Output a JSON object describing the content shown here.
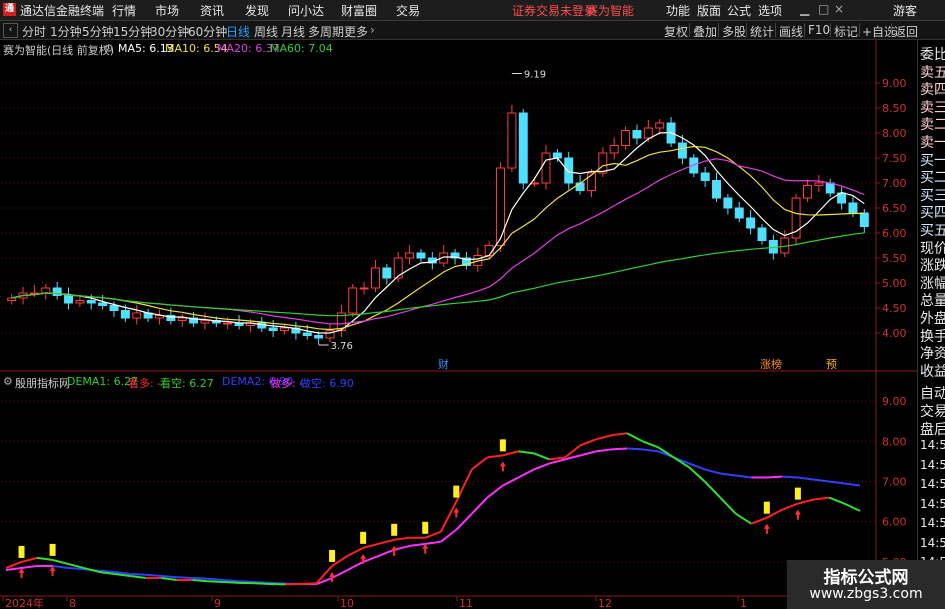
{
  "menubar": {
    "app_title": "通达信金融终端",
    "items": [
      "行情",
      "市场",
      "资讯",
      "发现",
      "问小达",
      "财富圈",
      "交易"
    ],
    "login_notice": "证券交易未登录",
    "stock_name": "赛为智能",
    "right_items": [
      "功能",
      "版面",
      "公式",
      "选项"
    ],
    "guest": "游客",
    "corner": "R"
  },
  "toolbar": {
    "periods": [
      "分时",
      "1分钟",
      "5分钟",
      "15分钟",
      "30分钟",
      "60分钟",
      "日线",
      "周线",
      "月线",
      "多周期",
      "更多"
    ],
    "active": "日线",
    "right_buttons": [
      "复权",
      "叠加",
      "多股",
      "统计",
      "画线",
      "F10",
      "标记",
      "+自选",
      "返回"
    ]
  },
  "main_chart": {
    "title": "赛为智能(日线 前复权)",
    "legend": [
      {
        "label": "MA5: 6.13",
        "color": "#ffffff"
      },
      {
        "label": "MA10: 6.54",
        "color": "#f0e040"
      },
      {
        "label": "MA20: 6.37",
        "color": "#e040e0"
      },
      {
        "label": "MA60: 7.04",
        "color": "#30d030"
      }
    ],
    "high_label": "9.19",
    "low_label": "3.76",
    "event_labels": [
      "财",
      "涨榜",
      "预"
    ],
    "y_ticks": [
      "9.00",
      "8.50",
      "8.00",
      "7.50",
      "7.00",
      "6.50",
      "6.00",
      "5.50",
      "5.00",
      "4.50",
      "4.00"
    ]
  },
  "indicator": {
    "name": "殷朋指标网",
    "legend": [
      {
        "label": "DEMA1: 6.27",
        "color": "#30d030"
      },
      {
        "label": "看多: -",
        "color": "#ff3030"
      },
      {
        "label": "看空: 6.27",
        "color": "#30d030"
      },
      {
        "label": "DEMA2: 6.90",
        "color": "#3040ff"
      },
      {
        "label": "做多: -",
        "color": "#ff30ff"
      },
      {
        "label": "做空: 6.90",
        "color": "#3040ff"
      }
    ],
    "y_ticks": [
      "9.00",
      "8.00",
      "7.00",
      "6.00",
      "5.00"
    ]
  },
  "x_axis": {
    "labels": [
      "2024年",
      "8",
      "9",
      "10",
      "11",
      "12",
      "1"
    ]
  },
  "right_panel": {
    "quote_labels": [
      "委比",
      "卖五",
      "卖四",
      "卖三",
      "卖二",
      "卖一",
      "买一",
      "买二",
      "买三",
      "买四",
      "买五",
      "现价",
      "涨跌",
      "涨幅",
      "总量",
      "外盘",
      "换手",
      "净资",
      "收益"
    ],
    "tabs": [
      "自动",
      "交易",
      "盘后"
    ],
    "times": [
      "14:56",
      "14:56",
      "14:56",
      "14:56",
      "14:56",
      "14:56",
      "14:56",
      "14:56"
    ]
  },
  "watermark": {
    "title": "指标公式网",
    "url": "www.zbgs3.com"
  },
  "chart_data": [
    {
      "type": "candlestick",
      "title": "赛为智能(日线 前复权)",
      "ylim": [
        3.5,
        9.5
      ],
      "x": [
        "2024-07",
        "2024-08",
        "2024-09",
        "2024-10",
        "2024-11",
        "2024-12",
        "2025-01"
      ],
      "close": [
        4.7,
        4.8,
        4.8,
        4.9,
        4.75,
        4.6,
        4.65,
        4.6,
        4.55,
        4.45,
        4.3,
        4.4,
        4.3,
        4.35,
        4.25,
        4.3,
        4.2,
        4.25,
        4.2,
        4.2,
        4.15,
        4.2,
        4.1,
        4.05,
        4.1,
        4.0,
        3.95,
        3.9,
        4.05,
        4.4,
        4.9,
        4.9,
        5.3,
        5.1,
        5.5,
        5.6,
        5.5,
        5.4,
        5.6,
        5.5,
        5.35,
        5.55,
        5.75,
        7.3,
        8.4,
        7.0,
        7.0,
        7.6,
        7.5,
        7.0,
        6.85,
        7.2,
        7.6,
        7.75,
        8.05,
        7.9,
        8.1,
        8.2,
        7.8,
        7.5,
        7.2,
        7.05,
        6.7,
        6.5,
        6.3,
        6.1,
        5.85,
        5.6,
        5.9,
        6.7,
        6.95,
        7.0,
        6.8,
        6.6,
        6.4,
        6.13
      ],
      "high_marker": 9.19,
      "low_marker": 3.76,
      "series": [
        {
          "name": "MA5",
          "last": 6.13
        },
        {
          "name": "MA10",
          "last": 6.54
        },
        {
          "name": "MA20",
          "last": 6.37
        },
        {
          "name": "MA60",
          "last": 7.04
        }
      ]
    },
    {
      "type": "line",
      "title": "殷朋指标网",
      "ylim": [
        4.6,
        9.4
      ],
      "series": [
        {
          "name": "DEMA1",
          "values": [
            4.85,
            5.0,
            5.1,
            5.05,
            4.95,
            4.85,
            4.75,
            4.7,
            4.65,
            4.6,
            4.6,
            4.55,
            4.55,
            4.52,
            4.5,
            4.48,
            4.47,
            4.45,
            4.44,
            4.45,
            4.47,
            4.9,
            5.15,
            5.35,
            5.45,
            5.55,
            5.6,
            5.6,
            5.75,
            6.5,
            7.3,
            7.6,
            7.65,
            7.75,
            7.7,
            7.55,
            7.6,
            7.9,
            8.05,
            8.15,
            8.2,
            8.0,
            7.85,
            7.6,
            7.35,
            7.0,
            6.6,
            6.2,
            5.95,
            6.1,
            6.3,
            6.45,
            6.55,
            6.6,
            6.45,
            6.27
          ]
        },
        {
          "name": "DEMA2",
          "values": [
            4.8,
            4.85,
            4.9,
            4.9,
            4.85,
            4.82,
            4.78,
            4.75,
            4.7,
            4.68,
            4.65,
            4.62,
            4.6,
            4.58,
            4.55,
            4.52,
            4.5,
            4.48,
            4.46,
            4.45,
            4.45,
            4.6,
            4.8,
            5.0,
            5.15,
            5.3,
            5.4,
            5.45,
            5.5,
            5.8,
            6.2,
            6.6,
            6.9,
            7.1,
            7.3,
            7.45,
            7.55,
            7.65,
            7.75,
            7.8,
            7.82,
            7.8,
            7.75,
            7.6,
            7.45,
            7.3,
            7.2,
            7.15,
            7.1,
            7.1,
            7.12,
            7.1,
            7.05,
            7.0,
            6.95,
            6.9
          ]
        }
      ]
    }
  ]
}
